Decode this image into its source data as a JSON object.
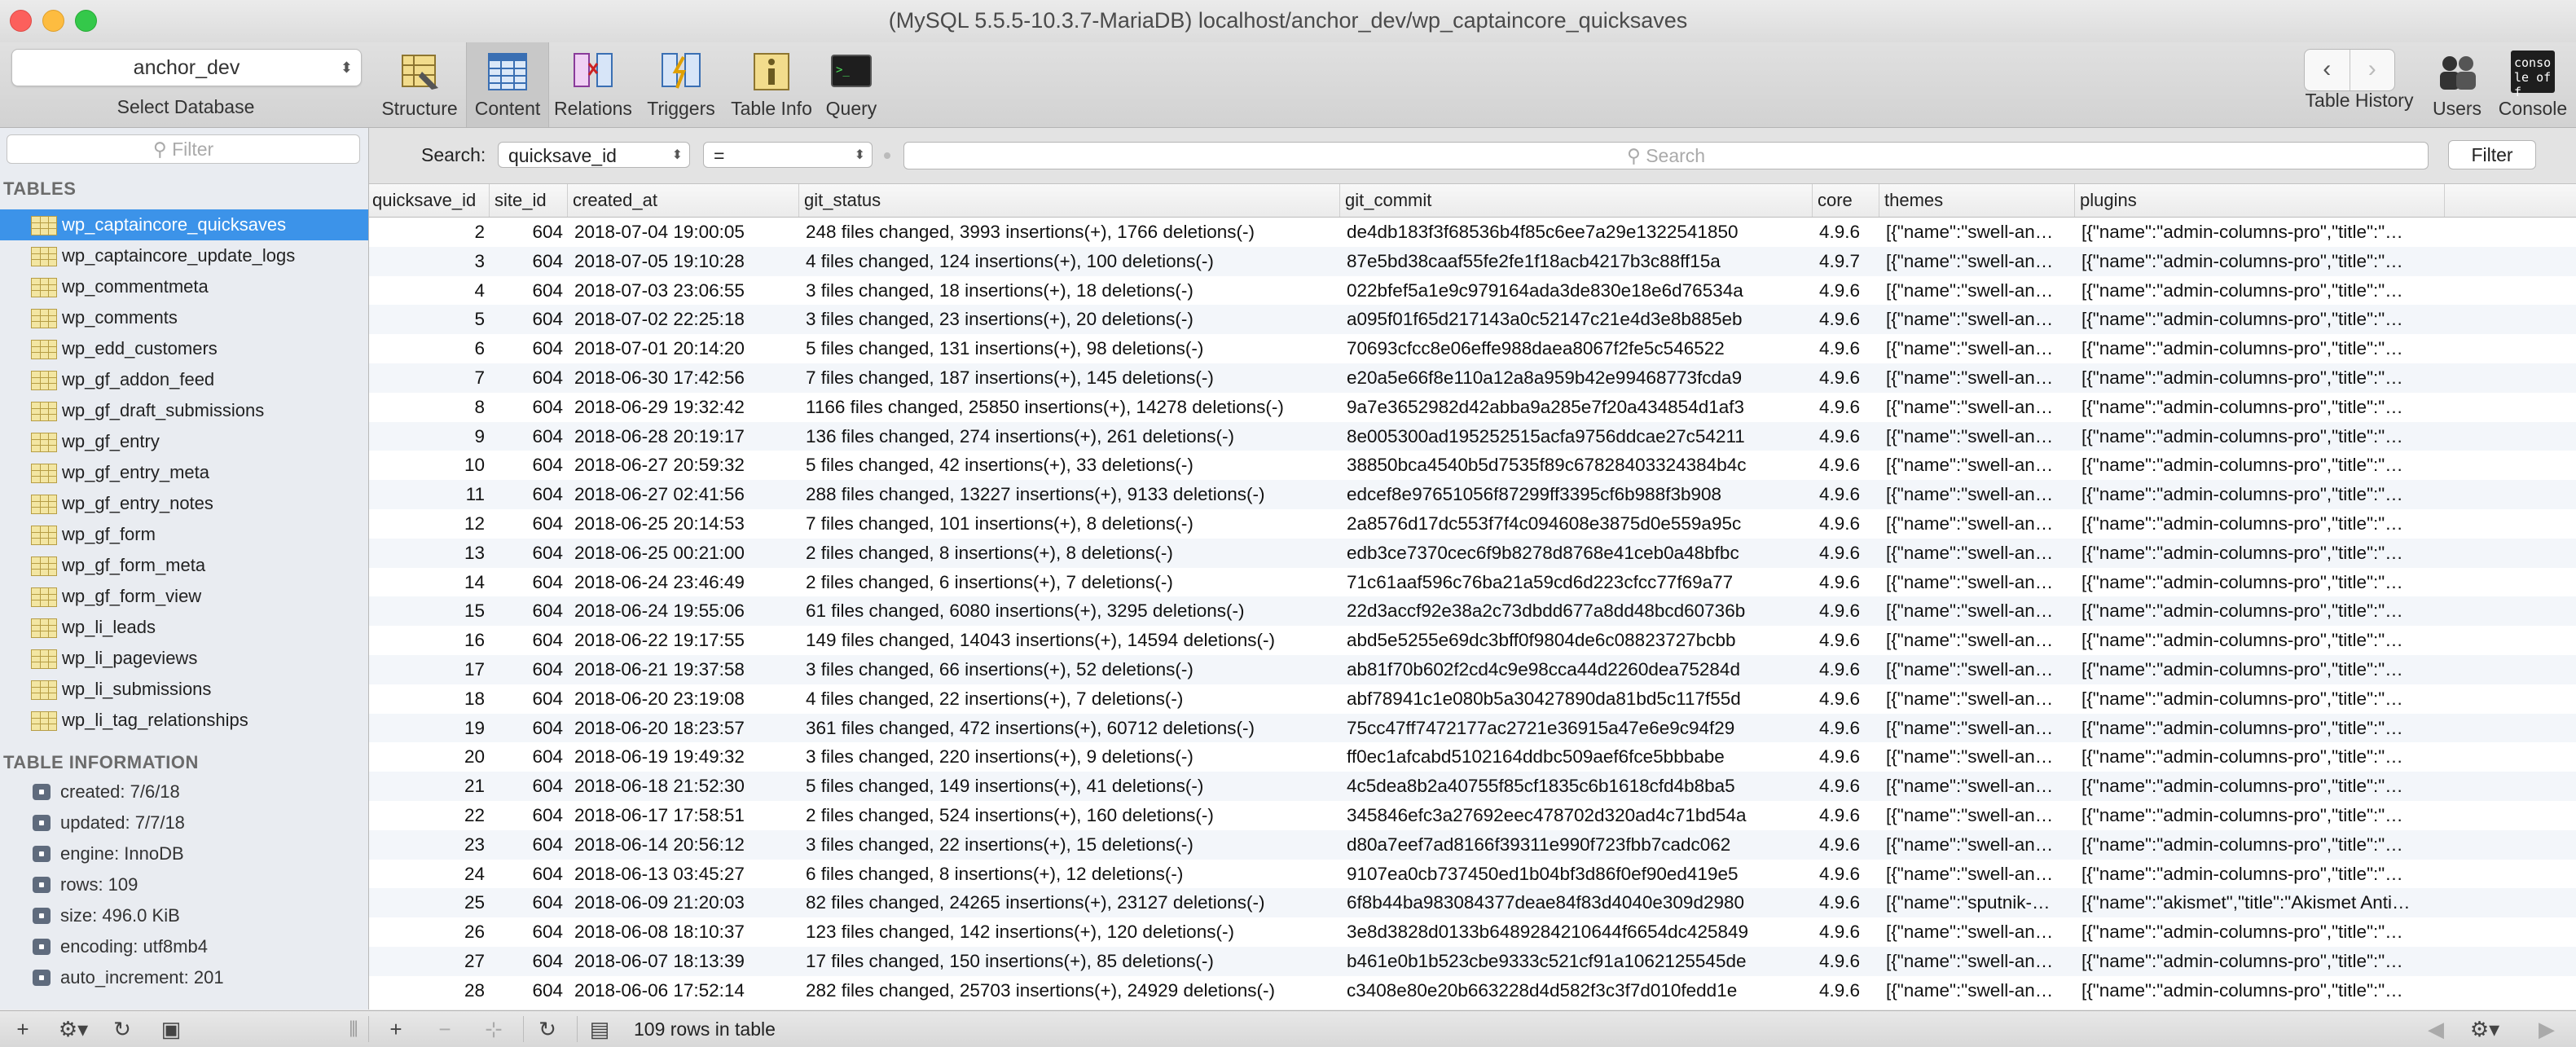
{
  "window": {
    "title": "(MySQL 5.5.5-10.3.7-MariaDB) localhost/anchor_dev/wp_captaincore_quicksaves"
  },
  "toolbar": {
    "database": "anchor_dev",
    "select_database_label": "Select Database",
    "structure": "Structure",
    "content": "Content",
    "relations": "Relations",
    "triggers": "Triggers",
    "table_info": "Table Info",
    "query": "Query",
    "table_history": "Table History",
    "users": "Users",
    "console": "Console",
    "console_icon_text": "conso le off"
  },
  "sidebar": {
    "filter_placeholder": "Filter",
    "tables_header": "TABLES",
    "tables": [
      "wp_captaincore_quicksaves",
      "wp_captaincore_update_logs",
      "wp_commentmeta",
      "wp_comments",
      "wp_edd_customers",
      "wp_gf_addon_feed",
      "wp_gf_draft_submissions",
      "wp_gf_entry",
      "wp_gf_entry_meta",
      "wp_gf_entry_notes",
      "wp_gf_form",
      "wp_gf_form_meta",
      "wp_gf_form_view",
      "wp_li_leads",
      "wp_li_pageviews",
      "wp_li_submissions",
      "wp_li_tag_relationships"
    ],
    "selected_table": "wp_captaincore_quicksaves",
    "info_header": "TABLE INFORMATION",
    "info": [
      "created: 7/6/18",
      "updated: 7/7/18",
      "engine: InnoDB",
      "rows: 109",
      "size: 496.0 KiB",
      "encoding: utf8mb4",
      "auto_increment: 201"
    ]
  },
  "search": {
    "label": "Search:",
    "field": "quicksave_id",
    "operator": "=",
    "placeholder": "Search",
    "filter_button": "Filter"
  },
  "grid": {
    "columns": [
      "quicksave_id",
      "site_id",
      "created_at",
      "git_status",
      "git_commit",
      "core",
      "themes",
      "plugins"
    ],
    "rows": [
      [
        "2",
        "604",
        "2018-07-04 19:00:05",
        "248 files changed, 3993 insertions(+), 1766 deletions(-)",
        "de4db183f3f68536b4f85c6ee7a29e1322541850",
        "4.9.6",
        "[{\"name\":\"swell-an…",
        "[{\"name\":\"admin-columns-pro\",\"title\":\"…"
      ],
      [
        "3",
        "604",
        "2018-07-05 19:10:28",
        "4 files changed, 124 insertions(+), 100 deletions(-)",
        "87e5bd38caaf55fe2fe1f18acb4217b3c88ff15a",
        "4.9.7",
        "[{\"name\":\"swell-an…",
        "[{\"name\":\"admin-columns-pro\",\"title\":\"…"
      ],
      [
        "4",
        "604",
        "2018-07-03 23:06:55",
        "3 files changed, 18 insertions(+), 18 deletions(-)",
        "022bfef5a1e9c979164ada3de830e18e6d76534a",
        "4.9.6",
        "[{\"name\":\"swell-an…",
        "[{\"name\":\"admin-columns-pro\",\"title\":\"…"
      ],
      [
        "5",
        "604",
        "2018-07-02 22:25:18",
        "3 files changed, 23 insertions(+), 20 deletions(-)",
        "a095f01f65d217143a0c52147c21e4d3e8b885eb",
        "4.9.6",
        "[{\"name\":\"swell-an…",
        "[{\"name\":\"admin-columns-pro\",\"title\":\"…"
      ],
      [
        "6",
        "604",
        "2018-07-01 20:14:20",
        "5 files changed, 131 insertions(+), 98 deletions(-)",
        "70693cfcc8e06effe988daea8067f2fe5c546522",
        "4.9.6",
        "[{\"name\":\"swell-an…",
        "[{\"name\":\"admin-columns-pro\",\"title\":\"…"
      ],
      [
        "7",
        "604",
        "2018-06-30 17:42:56",
        "7 files changed, 187 insertions(+), 145 deletions(-)",
        "e20a5e66f8e110a12a8a959b42e99468773fcda9",
        "4.9.6",
        "[{\"name\":\"swell-an…",
        "[{\"name\":\"admin-columns-pro\",\"title\":\"…"
      ],
      [
        "8",
        "604",
        "2018-06-29 19:32:42",
        "1166 files changed, 25850 insertions(+), 14278 deletions(-)",
        "9a7e3652982d42abba9a285e7f20a434854d1af3",
        "4.9.6",
        "[{\"name\":\"swell-an…",
        "[{\"name\":\"admin-columns-pro\",\"title\":\"…"
      ],
      [
        "9",
        "604",
        "2018-06-28 20:19:17",
        "136 files changed, 274 insertions(+), 261 deletions(-)",
        "8e005300ad195252515acfa9756ddcae27c54211",
        "4.9.6",
        "[{\"name\":\"swell-an…",
        "[{\"name\":\"admin-columns-pro\",\"title\":\"…"
      ],
      [
        "10",
        "604",
        "2018-06-27 20:59:32",
        "5 files changed, 42 insertions(+), 33 deletions(-)",
        "38850bca4540b5d7535f89c67828403324384b4c",
        "4.9.6",
        "[{\"name\":\"swell-an…",
        "[{\"name\":\"admin-columns-pro\",\"title\":\"…"
      ],
      [
        "11",
        "604",
        "2018-06-27 02:41:56",
        "288 files changed, 13227 insertions(+), 9133 deletions(-)",
        "edcef8e97651056f87299ff3395cf6b988f3b908",
        "4.9.6",
        "[{\"name\":\"swell-an…",
        "[{\"name\":\"admin-columns-pro\",\"title\":\"…"
      ],
      [
        "12",
        "604",
        "2018-06-25 20:14:53",
        "7 files changed, 101 insertions(+), 8 deletions(-)",
        "2a8576d17dc553f7f4c094608e3875d0e559a95c",
        "4.9.6",
        "[{\"name\":\"swell-an…",
        "[{\"name\":\"admin-columns-pro\",\"title\":\"…"
      ],
      [
        "13",
        "604",
        "2018-06-25 00:21:00",
        "2 files changed, 8 insertions(+), 8 deletions(-)",
        "edb3ce7370cec6f9b8278d8768e41ceb0a48bfbc",
        "4.9.6",
        "[{\"name\":\"swell-an…",
        "[{\"name\":\"admin-columns-pro\",\"title\":\"…"
      ],
      [
        "14",
        "604",
        "2018-06-24 23:46:49",
        "2 files changed, 6 insertions(+), 7 deletions(-)",
        "71c61aaf596c76ba21a59cd6d223cfcc77f69a77",
        "4.9.6",
        "[{\"name\":\"swell-an…",
        "[{\"name\":\"admin-columns-pro\",\"title\":\"…"
      ],
      [
        "15",
        "604",
        "2018-06-24 19:55:06",
        "61 files changed, 6080 insertions(+), 3295 deletions(-)",
        "22d3accf92e38a2c73dbdd677a8dd48bcd60736b",
        "4.9.6",
        "[{\"name\":\"swell-an…",
        "[{\"name\":\"admin-columns-pro\",\"title\":\"…"
      ],
      [
        "16",
        "604",
        "2018-06-22 19:17:55",
        "149 files changed, 14043 insertions(+), 14594 deletions(-)",
        "abd5e5255e69dc3bff0f9804de6c08823727bcbb",
        "4.9.6",
        "[{\"name\":\"swell-an…",
        "[{\"name\":\"admin-columns-pro\",\"title\":\"…"
      ],
      [
        "17",
        "604",
        "2018-06-21 19:37:58",
        "3 files changed, 66 insertions(+), 52 deletions(-)",
        "ab81f70b602f2cd4c9e98cca44d2260dea75284d",
        "4.9.6",
        "[{\"name\":\"swell-an…",
        "[{\"name\":\"admin-columns-pro\",\"title\":\"…"
      ],
      [
        "18",
        "604",
        "2018-06-20 23:19:08",
        "4 files changed, 22 insertions(+), 7 deletions(-)",
        "abf78941c1e080b5a30427890da81bd5c117f55d",
        "4.9.6",
        "[{\"name\":\"swell-an…",
        "[{\"name\":\"admin-columns-pro\",\"title\":\"…"
      ],
      [
        "19",
        "604",
        "2018-06-20 18:23:57",
        "361 files changed, 472 insertions(+), 60712 deletions(-)",
        "75cc47ff7472177ac2721e36915a47e6e9c94f29",
        "4.9.6",
        "[{\"name\":\"swell-an…",
        "[{\"name\":\"admin-columns-pro\",\"title\":\"…"
      ],
      [
        "20",
        "604",
        "2018-06-19 19:49:32",
        "3 files changed, 220 insertions(+), 9 deletions(-)",
        "ff0ec1afcabd5102164ddbc509aef6fce5bbbabe",
        "4.9.6",
        "[{\"name\":\"swell-an…",
        "[{\"name\":\"admin-columns-pro\",\"title\":\"…"
      ],
      [
        "21",
        "604",
        "2018-06-18 21:52:30",
        "5 files changed, 149 insertions(+), 41 deletions(-)",
        "4c5dea8b2a40755f85cf1835c6b1618cfd4b8ba5",
        "4.9.6",
        "[{\"name\":\"swell-an…",
        "[{\"name\":\"admin-columns-pro\",\"title\":\"…"
      ],
      [
        "22",
        "604",
        "2018-06-17 17:58:51",
        "2 files changed, 524 insertions(+), 160 deletions(-)",
        "345846efc3a27692eec478702d320ad4c71bd54a",
        "4.9.6",
        "[{\"name\":\"swell-an…",
        "[{\"name\":\"admin-columns-pro\",\"title\":\"…"
      ],
      [
        "23",
        "604",
        "2018-06-14 20:56:12",
        "3 files changed, 22 insertions(+), 15 deletions(-)",
        "d80a7eef7ad8166f39311e990f723fbb7cadc062",
        "4.9.6",
        "[{\"name\":\"swell-an…",
        "[{\"name\":\"admin-columns-pro\",\"title\":\"…"
      ],
      [
        "24",
        "604",
        "2018-06-13 03:45:27",
        "6 files changed, 8 insertions(+), 12 deletions(-)",
        "9107ea0cb737450ed1b04bf3d86f0ef90ed419e5",
        "4.9.6",
        "[{\"name\":\"swell-an…",
        "[{\"name\":\"admin-columns-pro\",\"title\":\"…"
      ],
      [
        "25",
        "604",
        "2018-06-09 21:20:03",
        "82 files changed, 24265 insertions(+), 23127 deletions(-)",
        "6f8b44ba983084377deae84f83d4040e309d2980",
        "4.9.6",
        "[{\"name\":\"sputnik-…",
        "[{\"name\":\"akismet\",\"title\":\"Akismet Anti…"
      ],
      [
        "26",
        "604",
        "2018-06-08 18:10:37",
        "123 files changed, 142 insertions(+), 120 deletions(-)",
        "3e8d3828d0133b6489284210644f6654dc425849",
        "4.9.6",
        "[{\"name\":\"swell-an…",
        "[{\"name\":\"admin-columns-pro\",\"title\":\"…"
      ],
      [
        "27",
        "604",
        "2018-06-07 18:13:39",
        "17 files changed, 150 insertions(+), 85 deletions(-)",
        "b461e0b1b523cbe9333c521cf91a1062125545de",
        "4.9.6",
        "[{\"name\":\"swell-an…",
        "[{\"name\":\"admin-columns-pro\",\"title\":\"…"
      ],
      [
        "28",
        "604",
        "2018-06-06 17:52:14",
        "282 files changed, 25703 insertions(+), 24929 deletions(-)",
        "c3408e80e20b663228d4d582f3c3f7d010fedd1e",
        "4.9.6",
        "[{\"name\":\"swell-an…",
        "[{\"name\":\"admin-columns-pro\",\"title\":\"…"
      ]
    ]
  },
  "footer": {
    "row_count": "109 rows in table"
  },
  "colors": {
    "selection": "#3c93e9",
    "sidebar_bg": "#e9ecf1",
    "stripe": "#f3f6fa"
  }
}
